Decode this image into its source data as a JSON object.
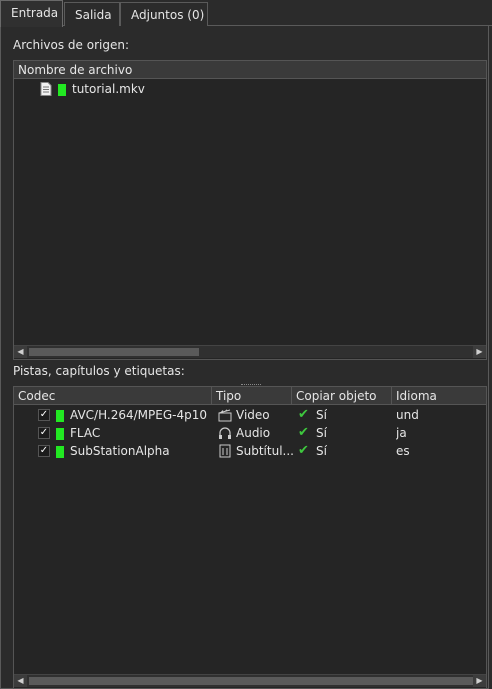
{
  "tabs": [
    {
      "label": "Entrada"
    },
    {
      "label": "Salida"
    },
    {
      "label": "Adjuntos (0)"
    }
  ],
  "source_files": {
    "label": "Archivos de origen:",
    "column_header": "Nombre de archivo",
    "files": [
      {
        "name": "tutorial.mkv",
        "icon": "file-icon",
        "color": "#22e822"
      }
    ]
  },
  "tracks": {
    "label": "Pistas, capítulos y etiquetas:",
    "columns": [
      "Codec",
      "Tipo",
      "Copiar objeto",
      "Idioma"
    ],
    "rows": [
      {
        "checked": true,
        "codec": "AVC/H.264/MPEG-4p10",
        "type": "Video",
        "type_icon": "video-icon",
        "copy": "Sí",
        "language": "und"
      },
      {
        "checked": true,
        "codec": "FLAC",
        "type": "Audio",
        "type_icon": "headphones-icon",
        "copy": "Sí",
        "language": "ja"
      },
      {
        "checked": true,
        "codec": "SubStationAlpha",
        "type": "Subtítul...",
        "type_icon": "subtitle-icon",
        "copy": "Sí",
        "language": "es"
      }
    ]
  },
  "colors": {
    "track_marker": "#22e822",
    "checkmark": "#3ec83e"
  }
}
